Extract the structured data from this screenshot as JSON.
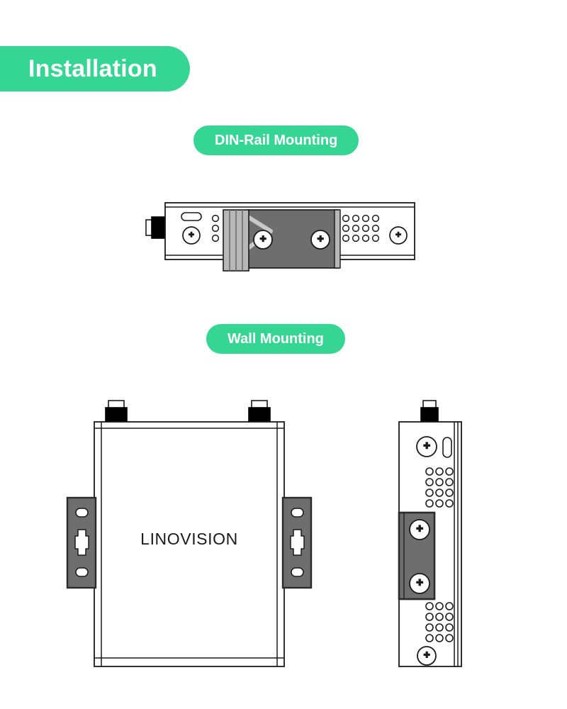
{
  "page": {
    "background": "#FFFFFF",
    "accent_color": "#35D693",
    "heading": "Installation"
  },
  "sections": [
    {
      "id": "din-rail",
      "label": "DIN-Rail Mounting",
      "figure": {
        "view": "top-down horizontal device with DIN-rail clip",
        "brand": "",
        "colors": {
          "body_fill": "#FFFFFF",
          "outline": "#1A1A1A",
          "clip_fill": "#6E6E6E",
          "clip_stripe": "#B8B8B8",
          "connector_fill": "#000000"
        },
        "parts": [
          {
            "name": "power-connector",
            "shape": "black-block",
            "count": 1
          },
          {
            "name": "indicator-slot",
            "shape": "rounded-rect",
            "count": 1
          },
          {
            "name": "screw",
            "shape": "phillips-circle",
            "count": 4
          },
          {
            "name": "vent-holes-left",
            "shape": "circle-grid",
            "columns": 1,
            "rows": 3
          },
          {
            "name": "vent-holes-right",
            "shape": "circle-grid",
            "columns": 4,
            "rows": 3
          },
          {
            "name": "din-rail-clip",
            "shape": "striped-bracket",
            "count": 1
          },
          {
            "name": "clip-arrow",
            "shape": "chevron",
            "count": 1
          }
        ]
      }
    },
    {
      "id": "wall",
      "label": "Wall Mounting",
      "figures": [
        {
          "view": "front",
          "brand": "LINOVISION",
          "colors": {
            "body_fill": "#FFFFFF",
            "outline": "#1A1A1A",
            "bracket_fill": "#6E6E6E",
            "antenna_fill": "#000000"
          },
          "parts": [
            {
              "name": "antenna-connector",
              "count": 2
            },
            {
              "name": "wall-bracket",
              "count": 2
            },
            {
              "name": "bracket-round-hole",
              "count": 4
            },
            {
              "name": "bracket-keyhole-slot",
              "count": 2
            }
          ]
        },
        {
          "view": "side",
          "brand": "",
          "colors": {
            "body_fill": "#FFFFFF",
            "outline": "#1A1A1A",
            "bracket_fill": "#6E6E6E",
            "antenna_fill": "#000000"
          },
          "parts": [
            {
              "name": "antenna-connector",
              "count": 1
            },
            {
              "name": "screw",
              "shape": "phillips-circle",
              "count": 4
            },
            {
              "name": "indicator-slot",
              "shape": "rounded-rect",
              "count": 1
            },
            {
              "name": "vent-holes-top",
              "columns": 3,
              "rows": 4
            },
            {
              "name": "vent-holes-bottom",
              "columns": 3,
              "rows": 4
            },
            {
              "name": "wall-bracket",
              "count": 1
            }
          ]
        }
      ]
    }
  ]
}
